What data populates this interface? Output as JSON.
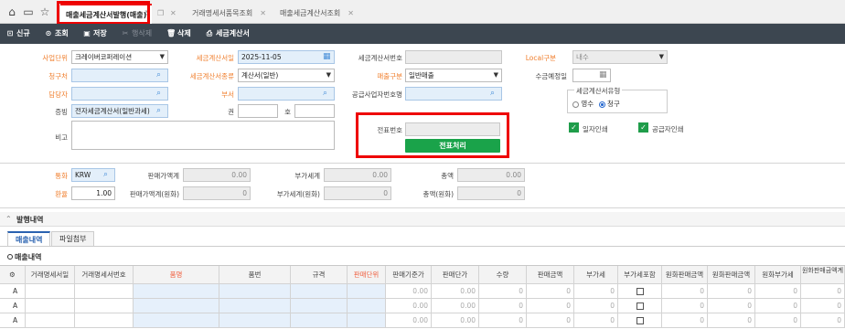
{
  "tabs": [
    {
      "label": "매출세금계산서발행(매출)"
    },
    {
      "label": "거래명세서품목조회"
    },
    {
      "label": "매출세금계산서조회"
    }
  ],
  "toolbar": {
    "new": "신규",
    "search": "조회",
    "save": "저장",
    "row_delete": "행삭제",
    "delete": "삭제",
    "tax_invoice": "세금계산서"
  },
  "form": {
    "business_unit": {
      "label": "사업단위",
      "value": "크레이버코퍼레이션"
    },
    "invoice_date": {
      "label": "세금계산서일",
      "value": "2025-11-05"
    },
    "invoice_no": {
      "label": "세금계산서번호",
      "value": ""
    },
    "local_type": {
      "label": "Local구분",
      "value": "내수"
    },
    "billing_to": {
      "label": "청구처",
      "value": ""
    },
    "invoice_kind": {
      "label": "세금계산서종류",
      "value": "계산서(일반)"
    },
    "sales_type": {
      "label": "매출구분",
      "value": "일반매출"
    },
    "collect_date": {
      "label": "수금예정일",
      "value": ""
    },
    "manager": {
      "label": "담당자",
      "value": ""
    },
    "dept": {
      "label": "부서",
      "value": ""
    },
    "supplier_biz": {
      "label": "공급사업자번호명",
      "value": ""
    },
    "invoice_type_group": {
      "label": "세금계산서유형",
      "opt1": "영수",
      "opt2": "청구"
    },
    "evidence": {
      "label": "증빙",
      "value": "전자세금계산서(일반과세)"
    },
    "book": {
      "label": "권",
      "value": ""
    },
    "ho": {
      "label": "호",
      "value": ""
    },
    "remark": {
      "label": "비고",
      "value": ""
    },
    "slip_no": {
      "label": "전표번호",
      "value": ""
    },
    "slip_button": "전표처리",
    "print_date": "일자인쇄",
    "print_supplier": "공급자인쇄"
  },
  "amounts": {
    "currency": {
      "label": "통화",
      "value": "KRW"
    },
    "sale_amt": {
      "label": "판매가액계",
      "value": "0.00"
    },
    "vat_total": {
      "label": "부가세계",
      "value": "0.00"
    },
    "total": {
      "label": "총액",
      "value": "0.00"
    },
    "rate": {
      "label": "환율",
      "value": "1.00"
    },
    "sale_amt_krw": {
      "label": "판매가액계(원화)",
      "value": "0"
    },
    "vat_krw": {
      "label": "부가세계(원화)",
      "value": "0"
    },
    "total_krw": {
      "label": "총액(원화)",
      "value": "0"
    }
  },
  "detail": {
    "section_title": "발행내역",
    "subtabs": [
      "매출내역",
      "파일첨부"
    ],
    "grid_title": "매출내역",
    "columns": [
      "거래명세서일",
      "거래명세서번호",
      "품명",
      "품번",
      "규격",
      "판매단위",
      "판매기준가",
      "판매단가",
      "수량",
      "판매금액",
      "부가세",
      "부가세포함",
      "원화판매금액",
      "원화판매금액",
      "원화부가세",
      "원화판매금액계"
    ],
    "rows": [
      {
        "no": "A",
        "v": [
          "0.00",
          "0.00",
          "0",
          "0",
          "0",
          "0",
          "0",
          "0",
          "0"
        ]
      },
      {
        "no": "A",
        "v": [
          "0.00",
          "0.00",
          "0",
          "0",
          "0",
          "0",
          "0",
          "0",
          "0"
        ]
      },
      {
        "no": "A",
        "v": [
          "0.00",
          "0.00",
          "0",
          "0",
          "0",
          "0",
          "0",
          "0",
          "0"
        ]
      }
    ]
  }
}
